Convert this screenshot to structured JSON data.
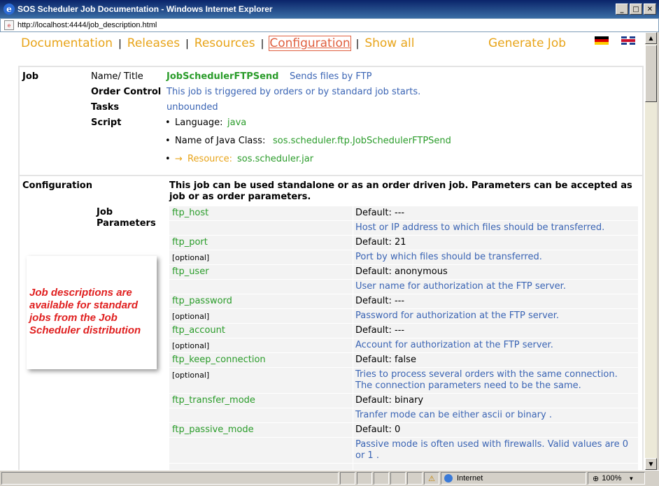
{
  "window": {
    "title": "SOS Scheduler Job Documentation - Windows Internet Explorer"
  },
  "address": {
    "url": "http://localhost:4444/job_description.html"
  },
  "nav": {
    "items": [
      "Documentation",
      "Releases",
      "Resources",
      "Configuration",
      "Show all"
    ],
    "separator": "|",
    "generate_job": "Generate Job"
  },
  "job": {
    "label": "Job",
    "name_label": "Name/ Title",
    "name": "JobSchedulerFTPSend",
    "title": "Sends files by FTP",
    "order_control_label": "Order Control",
    "order_control": "This job is triggered by orders or by standard job starts.",
    "tasks_label": "Tasks",
    "tasks": "unbounded",
    "script_label": "Script",
    "language_label": "Language:",
    "language": "java",
    "java_class_label": "Name of Java Class:",
    "java_class": "sos.scheduler.ftp.JobSchedulerFTPSend",
    "resource_arrow": "→",
    "resource_label": "Resource:",
    "resource": "sos.scheduler.jar"
  },
  "configuration": {
    "label": "Configuration",
    "intro": "This job can be used standalone or as an order driven job. Parameters can be accepted as job or as order parameters.",
    "job_parameters_label": "Job Parameters",
    "params": [
      {
        "name": "ftp_host",
        "default": "Default: ---",
        "optional": "",
        "description": "Host or IP address to which files should be transferred."
      },
      {
        "name": "ftp_port",
        "default": "Default: 21",
        "optional": "[optional]",
        "description": "Port by which files should be transferred."
      },
      {
        "name": "ftp_user",
        "default": "Default: anonymous",
        "optional": "",
        "description": "User name for authorization at the FTP server."
      },
      {
        "name": "ftp_password",
        "default": "Default: ---",
        "optional": "[optional]",
        "description": "Password for authorization at the FTP server."
      },
      {
        "name": "ftp_account",
        "default": "Default: ---",
        "optional": "[optional]",
        "description": "Account for authorization at the FTP server."
      },
      {
        "name": "ftp_keep_connection",
        "default": "Default: false",
        "optional": "[optional]",
        "description": "Tries to process several orders with the same connection. The connection parameters need to be the same."
      },
      {
        "name": "ftp_transfer_mode",
        "default": "Default: binary",
        "optional": "",
        "description": "Tranfer mode can be either ascii or binary ."
      },
      {
        "name": "ftp_passive_mode",
        "default": "Default: 0",
        "optional": "",
        "description": "Passive mode is often used with firewalls. Valid values are 0 or 1 ."
      }
    ]
  },
  "callout": {
    "text": "Job descriptions are available for standard jobs from the Job Scheduler distribution"
  },
  "status": {
    "zone": "Internet",
    "zoom": "100%"
  }
}
